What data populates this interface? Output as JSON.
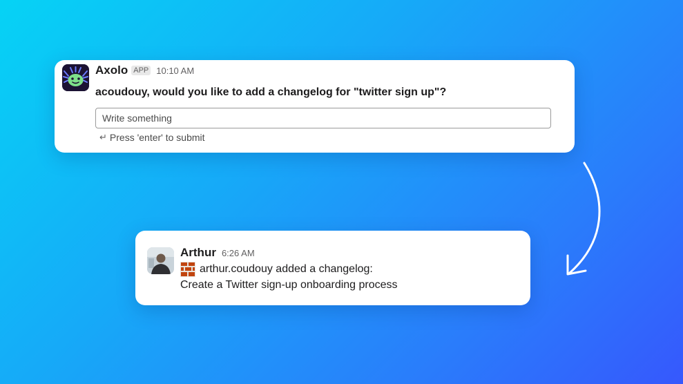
{
  "axolo_message": {
    "sender": "Axolo",
    "badge": "APP",
    "time": "10:10 AM",
    "text": "acoudouy, would you like to add a changelog for \"twitter sign up\"?",
    "input_placeholder": "Write something",
    "submit_hint_icon": "↵",
    "submit_hint": "Press 'enter' to submit",
    "avatar_icon": "axolotl-logo-icon"
  },
  "arthur_message": {
    "sender": "Arthur",
    "time": "6:26 AM",
    "emoji_icon": "brick-icon",
    "line1": "arthur.coudouy added a changelog:",
    "line2": "Create a Twitter sign-up onboarding process",
    "avatar_icon": "user-photo-avatar"
  },
  "arrow_icon": "curved-down-arrow-icon",
  "colors": {
    "background_start": "#06d3f5",
    "background_end": "#3658fd",
    "card": "#ffffff",
    "axolo_avatar_bg": "#1c1233",
    "axolo_face": "#7ee08a"
  }
}
